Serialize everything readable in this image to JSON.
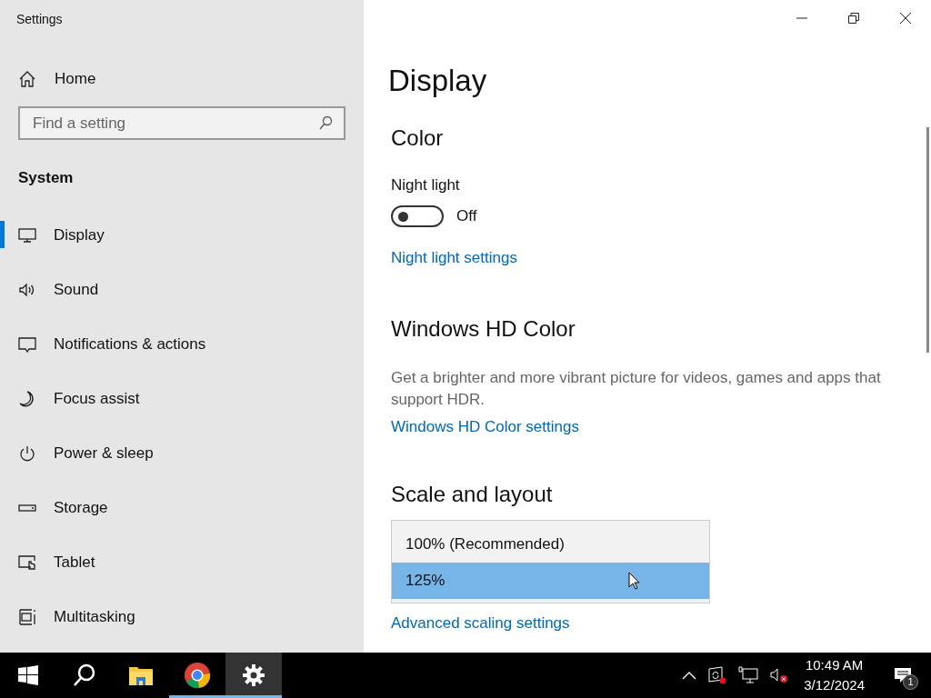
{
  "window": {
    "title": "Settings"
  },
  "sidebar": {
    "home": "Home",
    "search": {
      "placeholder": "Find a setting"
    },
    "section": "System",
    "items": [
      {
        "label": "Display",
        "selected": true
      },
      {
        "label": "Sound",
        "selected": false
      },
      {
        "label": "Notifications & actions",
        "selected": false
      },
      {
        "label": "Focus assist",
        "selected": false
      },
      {
        "label": "Power & sleep",
        "selected": false
      },
      {
        "label": "Storage",
        "selected": false
      },
      {
        "label": "Tablet",
        "selected": false
      },
      {
        "label": "Multitasking",
        "selected": false
      }
    ]
  },
  "content": {
    "title": "Display",
    "color_heading": "Color",
    "night_light": {
      "label": "Night light",
      "on": false,
      "state_text": "Off"
    },
    "night_light_link": "Night light settings",
    "hdr_heading": "Windows HD Color",
    "hdr_description": "Get a brighter and more vibrant picture for videos, games and apps that support HDR.",
    "hdr_link": "Windows HD Color settings",
    "scale_heading": "Scale and layout",
    "scale_options": [
      {
        "label": "100% (Recommended)",
        "selected": false
      },
      {
        "label": "125%",
        "selected": true
      }
    ],
    "advanced_link": "Advanced scaling settings"
  },
  "taskbar": {
    "apps": [
      {
        "kind": "start",
        "running": false,
        "selected": false
      },
      {
        "kind": "search",
        "running": false,
        "selected": false
      },
      {
        "kind": "folder",
        "running": false,
        "selected": false
      },
      {
        "kind": "browser",
        "running": true,
        "selected": false
      },
      {
        "kind": "settings",
        "running": true,
        "selected": true
      }
    ],
    "time": "10:49 AM",
    "date": "3/12/2024",
    "notification_count": "1"
  }
}
